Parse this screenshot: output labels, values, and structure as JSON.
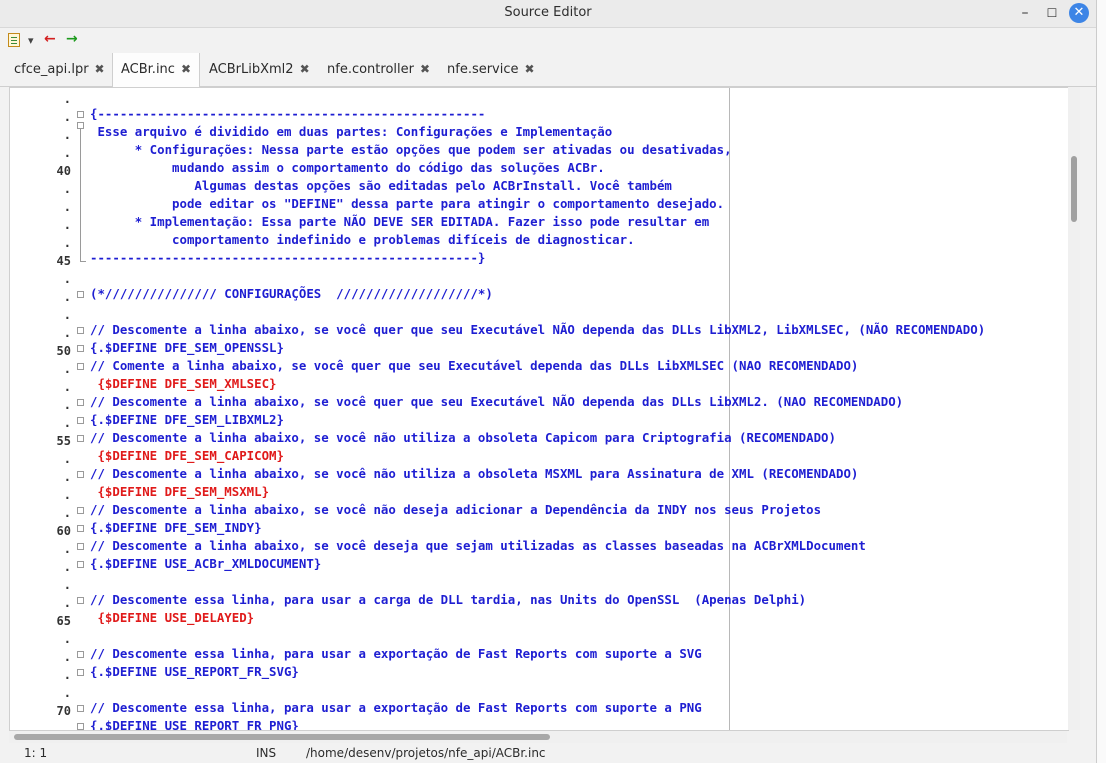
{
  "window": {
    "title": "Source Editor"
  },
  "toolbar": {
    "back_icon": "arrow-left-icon",
    "forward_icon": "arrow-right-icon"
  },
  "tabs": [
    {
      "label": "cfce_api.lpr"
    },
    {
      "label": "ACBr.inc"
    },
    {
      "label": "ACBrLibXml2"
    },
    {
      "label": "nfe.controller"
    },
    {
      "label": "nfe.service"
    }
  ],
  "gutter": {
    "dot": ".",
    "n40": "40",
    "n45": "45",
    "n50": "50",
    "n55": "55",
    "n60": "60",
    "n65": "65",
    "n70": "70"
  },
  "code": {
    "l0": "{----------------------------------------------------",
    "l1": " Esse arquivo é dividido em duas partes: Configurações e Implementação",
    "l2": "      * Configurações: Nessa parte estão opções que podem ser ativadas ou desativadas,",
    "l3": "           mudando assim o comportamento do código das soluções ACBr.",
    "l4": "              Algumas destas opções são editadas pelo ACBrInstall. Você também",
    "l5": "           pode editar os \"DEFINE\" dessa parte para atingir o comportamento desejado.",
    "l6": "      * Implementação: Essa parte NÃO DEVE SER EDITADA. Fazer isso pode resultar em",
    "l7": "           comportamento indefinido e problemas difíceis de diagnosticar.",
    "l8": "----------------------------------------------------}",
    "l10": "(*/////////////// CONFIGURAÇÕES  ///////////////////*)",
    "l12": "// Descomente a linha abaixo, se você quer que seu Executável NÃO dependa das DLLs LibXML2, LibXMLSEC, (NÃO RECOMENDADO)",
    "l13": "{.$DEFINE DFE_SEM_OPENSSL}",
    "l14": "// Comente a linha abaixo, se você quer que seu Executável dependa das DLLs LibXMLSEC (NAO RECOMENDADO)",
    "l15": " {$DEFINE DFE_SEM_XMLSEC}",
    "l16": "// Descomente a linha abaixo, se você quer que seu Executável NÃO dependa das DLLs LibXML2. (NAO RECOMENDADO)",
    "l17": "{.$DEFINE DFE_SEM_LIBXML2}",
    "l18": "// Descomente a linha abaixo, se você não utiliza a obsoleta Capicom para Criptografia (RECOMENDADO)",
    "l19": " {$DEFINE DFE_SEM_CAPICOM}",
    "l20": "// Descomente a linha abaixo, se você não utiliza a obsoleta MSXML para Assinatura de XML (RECOMENDADO)",
    "l21": " {$DEFINE DFE_SEM_MSXML}",
    "l22": "// Descomente a linha abaixo, se você não deseja adicionar a Dependência da INDY nos seus Projetos",
    "l23": "{.$DEFINE DFE_SEM_INDY}",
    "l24": "// Descomente a linha abaixo, se você deseja que sejam utilizadas as classes baseadas na ACBrXMLDocument",
    "l25": "{.$DEFINE USE_ACBr_XMLDOCUMENT}",
    "l28": "// Descomente essa linha, para usar a carga de DLL tardia, nas Units do OpenSSL  (Apenas Delphi)",
    "l29": " {$DEFINE USE_DELAYED}",
    "l31": "// Descomente essa linha, para usar a exportação de Fast Reports com suporte a SVG",
    "l32": "{.$DEFINE USE_REPORT_FR_SVG}",
    "l34": "// Descomente essa linha, para usar a exportação de Fast Reports com suporte a PNG",
    "l35": "{.$DEFINE USE_REPORT_FR_PNG}"
  },
  "status": {
    "position": "1: 1",
    "mode": "INS",
    "path": "/home/desenv/projetos/nfe_api/ACBr.inc"
  },
  "colors": {
    "code_blue": "#1e1ed2",
    "define_red": "#e01a1a",
    "close_button": "#3d85e6"
  }
}
